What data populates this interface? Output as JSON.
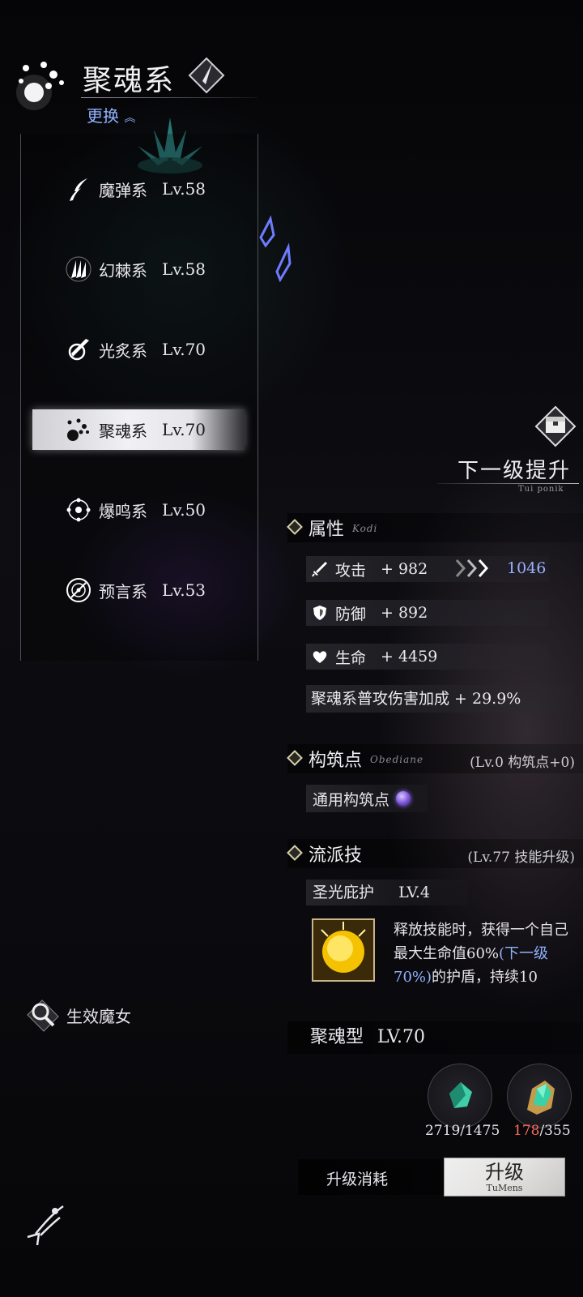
{
  "header": {
    "title": "聚魂系",
    "switch_label": "更换",
    "switch_icon": "chevron-up-double-icon"
  },
  "schools": [
    {
      "name": "魔弹系",
      "level": "Lv.58",
      "icon": "magic-bullet-icon",
      "selected": false
    },
    {
      "name": "幻棘系",
      "level": "Lv.58",
      "icon": "claw-icon",
      "selected": false
    },
    {
      "name": "光炙系",
      "level": "Lv.70",
      "icon": "light-orb-icon",
      "selected": false
    },
    {
      "name": "聚魂系",
      "level": "Lv.70",
      "icon": "soul-gather-icon",
      "selected": true
    },
    {
      "name": "爆鸣系",
      "level": "Lv.50",
      "icon": "burst-icon",
      "selected": false
    },
    {
      "name": "预言系",
      "level": "Lv.53",
      "icon": "prophecy-icon",
      "selected": false
    }
  ],
  "next_level": {
    "title": "下一级提升",
    "subtitle": "Tui ponik"
  },
  "attributes": {
    "title": "属性",
    "subtitle": "Kodi",
    "attack": {
      "label": "攻击",
      "value": "+ 982",
      "next": "1046"
    },
    "defense": {
      "label": "防御",
      "value": "+ 892"
    },
    "hp": {
      "label": "生命",
      "value": "+ 4459"
    },
    "bonus": "聚魂系普攻伤害加成 + 29.9%"
  },
  "build_points": {
    "title": "构筑点",
    "subtitle": "Obediane",
    "right_text": "(Lv.0 构筑点+0)",
    "item_label": "通用构筑点"
  },
  "school_skill": {
    "title": "流派技",
    "right_text": "(Lv.77 技能升级)",
    "skill_name": "圣光庇护",
    "skill_level": "LV.4",
    "desc_1": "释放技能时，获得一个自己最大生命值60%",
    "desc_hl": "(下一级70%)",
    "desc_2": "的护盾，持续10"
  },
  "type": {
    "label": "聚魂型",
    "level": "LV.70"
  },
  "materials": [
    {
      "icon": "green-crystal-icon",
      "have": "2719",
      "need": "/1475",
      "enough": true
    },
    {
      "icon": "green-ore-icon",
      "have": "178",
      "need": "/355",
      "enough": false
    }
  ],
  "cost": {
    "label": "升级消耗",
    "button": "升级",
    "button_sub": "TuMens"
  },
  "witch_button": "生效魔女",
  "colors": {
    "accent_blue": "#8fb2ff",
    "insufficient_red": "#ff6b5e",
    "selected_bg": "#e5e5ea"
  }
}
